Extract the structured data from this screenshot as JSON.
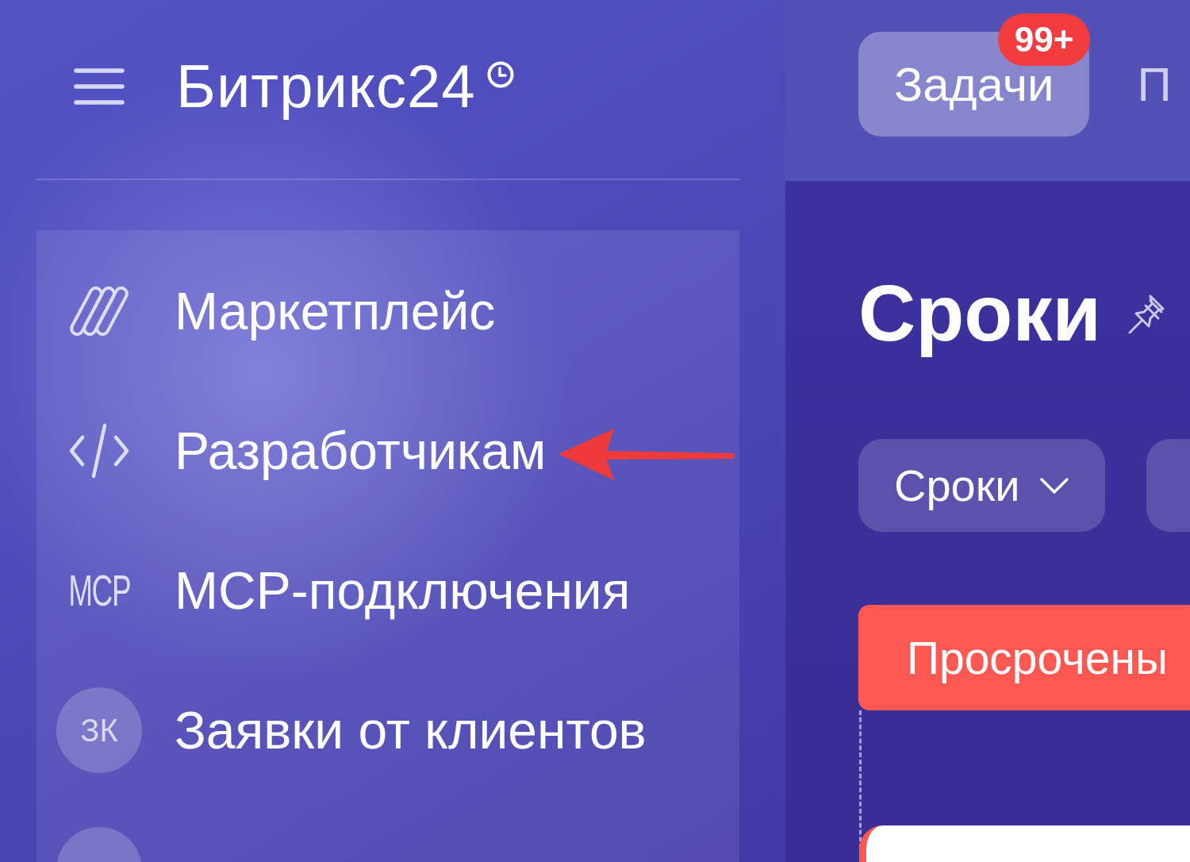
{
  "header": {
    "logo": "Битрикс24"
  },
  "menu": {
    "items": [
      {
        "kind": "icon",
        "label": "Маркетплейс",
        "arrow": false
      },
      {
        "kind": "icon",
        "label": "Разработчикам",
        "arrow": true
      },
      {
        "kind": "text_icon",
        "icon_text": "MCP",
        "label": "MCP-подключения",
        "arrow": false
      },
      {
        "kind": "avatar",
        "initials": "ЗК",
        "label": "Заявки от клиентов",
        "arrow": false
      },
      {
        "kind": "avatar",
        "arrow": false
      }
    ]
  },
  "top_bar": {
    "tabs": [
      {
        "label": "Задачи",
        "selected": true,
        "counter": "99+"
      },
      {
        "label": "П",
        "selected": false
      }
    ]
  },
  "page": {
    "title": "Сроки",
    "filters": [
      {
        "kind": "dropdown",
        "label": "Сроки"
      },
      {
        "kind": "button"
      }
    ],
    "columns": [
      {
        "title": "Просрочены",
        "color": "#ff5752"
      }
    ]
  }
}
